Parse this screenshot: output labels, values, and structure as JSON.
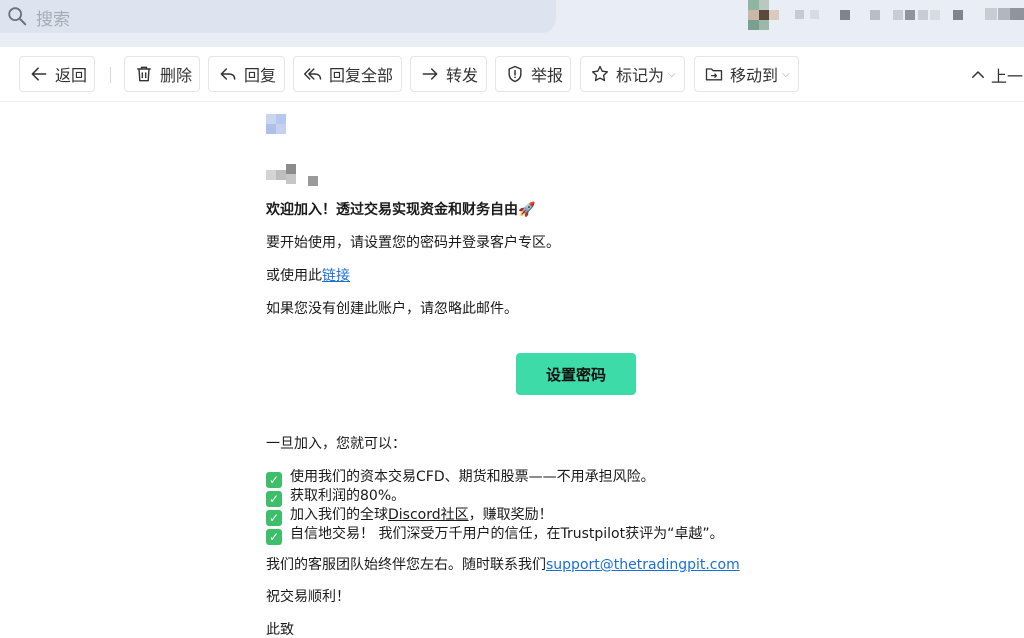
{
  "search": {
    "placeholder": "搜索"
  },
  "toolbar": {
    "back": "返回",
    "delete": "删除",
    "reply": "回复",
    "reply_all": "回复全部",
    "forward": "转发",
    "report": "举报",
    "mark_as": "标记为",
    "move_to": "移动到",
    "previous": "上一"
  },
  "email": {
    "heading": "欢迎加入！透过交易实现资金和财务自由",
    "heading_emoji": "🚀",
    "line1": "要开始使用，请设置您的密码并登录客户专区。",
    "line2_prefix": "或使用此",
    "line2_link": "链接",
    "line3": "如果您没有创建此账户，请忽略此邮件。",
    "cta_button": "设置密码",
    "benefits_intro": "一旦加入，您就可以：",
    "benefits": [
      "使用我们的资本交易CFD、期货和股票——不用承担风险。",
      "获取利润的80%。",
      {
        "prefix": "加入我们的全球",
        "link": "Discord社区",
        "suffix": "，赚取奖励！"
      },
      "自信地交易！ 我们深受万千用户的信任，在Trustpilot获评为“卓越”。"
    ],
    "support_prefix": "我们的客服团队始终伴您左右。随时联系我们",
    "support_email": "support@thetradingpit.com",
    "closing": "祝交易顺利！",
    "signoff": "此致"
  },
  "colors": {
    "accent_button": "#3ddba7",
    "link": "#1a6fd6",
    "check": "#3dbf6a"
  }
}
